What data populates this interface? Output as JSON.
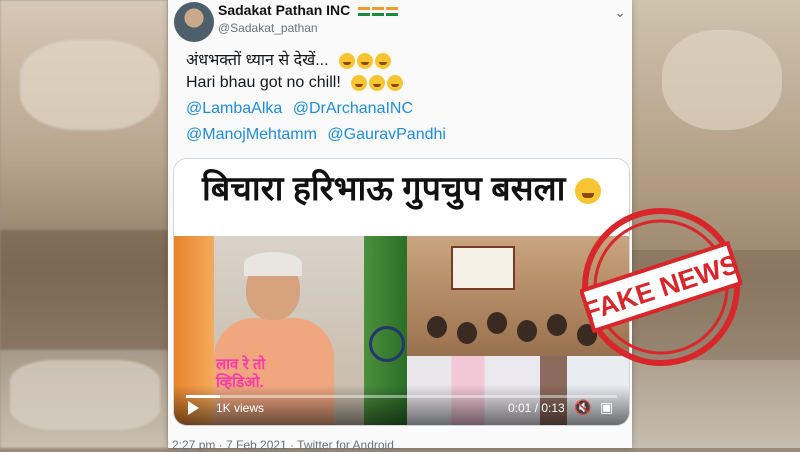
{
  "tweet": {
    "display_name": "Sadakat Pathan INC",
    "handle": "@Sadakat_pathan",
    "flag_icons": [
      "india-flag-icon",
      "india-flag-icon",
      "india-flag-icon"
    ],
    "menu_icon": "chevron-down-icon",
    "line1": "अंधभक्तों ध्यान से देखें...",
    "line2": "Hari bhau got no chill!",
    "mentions_row1": [
      "@LambaAlka",
      "@DrArchanaINC"
    ],
    "mentions_row2": [
      "@ManojMehtamm",
      "@GauravPandhi"
    ],
    "emoji": "laughing-emoji-icon",
    "footer": "2:27 pm · 7 Feb 2021 · Twitter for Android"
  },
  "video": {
    "banner_text": "बिचारा हरिभाऊ  गुपचुप बसला",
    "overlay_text_line1": "लाव रे तो",
    "overlay_text_line2": "व्हिडिओ.",
    "views": "1K views",
    "current_time": "0:01",
    "duration": "0:13",
    "time_separator": " / ",
    "progress_fraction": 0.08,
    "play_icon": "play-icon",
    "mute_icon": "mute-icon",
    "gif_icon": "gif-icon"
  },
  "stamp": {
    "text": "FAKE NEWS",
    "color": "#d8262a"
  }
}
